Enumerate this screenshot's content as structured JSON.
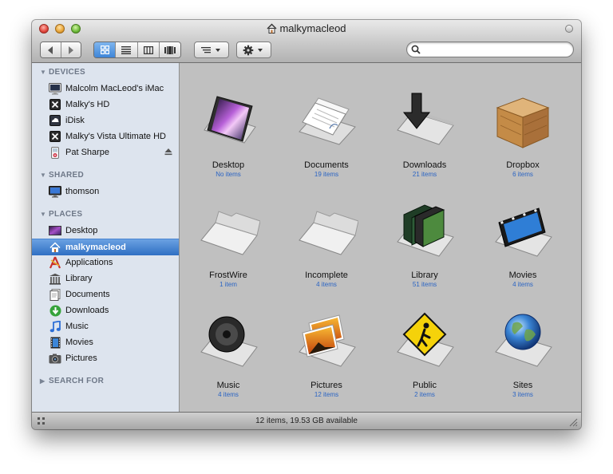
{
  "window": {
    "title": "malkymacleod",
    "status_text": "12 items, 19.53 GB available"
  },
  "toolbar": {
    "back_icon": "chevron-left-icon",
    "forward_icon": "chevron-right-icon",
    "views": [
      "icon-view",
      "list-view",
      "column-view",
      "coverflow-view"
    ],
    "selected_view": "icon-view",
    "arrange_icon": "arrange-icon",
    "action_icon": "gear-icon",
    "search_placeholder": "",
    "search_value": ""
  },
  "sidebar": {
    "devices_header": "DEVICES",
    "shared_header": "SHARED",
    "places_header": "PLACES",
    "search_header": "SEARCH FOR",
    "devices": [
      {
        "label": "Malcolm MacLeod's iMac",
        "icon": "imac-icon"
      },
      {
        "label": "Malky's HD",
        "icon": "bootcamp-drive-icon"
      },
      {
        "label": "iDisk",
        "icon": "idisk-icon"
      },
      {
        "label": "Malky's Vista Ultimate HD",
        "icon": "bootcamp-drive-icon"
      },
      {
        "label": "Pat Sharpe",
        "icon": "ipod-icon",
        "ejectable": true
      }
    ],
    "shared": [
      {
        "label": "thomson",
        "icon": "network-computer-icon"
      }
    ],
    "places": [
      {
        "label": "Desktop",
        "icon": "desktop-icon"
      },
      {
        "label": "malkymacleod",
        "icon": "home-icon",
        "selected": true
      },
      {
        "label": "Applications",
        "icon": "applications-icon"
      },
      {
        "label": "Library",
        "icon": "library-icon"
      },
      {
        "label": "Documents",
        "icon": "documents-icon"
      },
      {
        "label": "Downloads",
        "icon": "downloads-icon"
      },
      {
        "label": "Music",
        "icon": "music-icon"
      },
      {
        "label": "Movies",
        "icon": "movies-icon"
      },
      {
        "label": "Pictures",
        "icon": "pictures-icon"
      }
    ]
  },
  "items": [
    {
      "name": "Desktop",
      "count": "No items",
      "icon": "desktop-folder-icon"
    },
    {
      "name": "Documents",
      "count": "19 items",
      "icon": "documents-folder-icon"
    },
    {
      "name": "Downloads",
      "count": "21 items",
      "icon": "downloads-folder-icon"
    },
    {
      "name": "Dropbox",
      "count": "6 items",
      "icon": "dropbox-box-icon"
    },
    {
      "name": "FrostWire",
      "count": "1 item",
      "icon": "folder-icon"
    },
    {
      "name": "Incomplete",
      "count": "4 items",
      "icon": "folder-icon"
    },
    {
      "name": "Library",
      "count": "51 items",
      "icon": "library-folder-icon"
    },
    {
      "name": "Movies",
      "count": "4 items",
      "icon": "movies-folder-icon"
    },
    {
      "name": "Music",
      "count": "4 items",
      "icon": "music-folder-icon"
    },
    {
      "name": "Pictures",
      "count": "12 items",
      "icon": "pictures-folder-icon"
    },
    {
      "name": "Public",
      "count": "2 items",
      "icon": "public-folder-icon"
    },
    {
      "name": "Sites",
      "count": "3 items",
      "icon": "sites-folder-icon"
    }
  ],
  "colors": {
    "selection": "#3e7bd0",
    "sidebar_bg": "#dde4ee",
    "content_bg": "#c0c0c0",
    "item_count": "#2a64c4"
  }
}
